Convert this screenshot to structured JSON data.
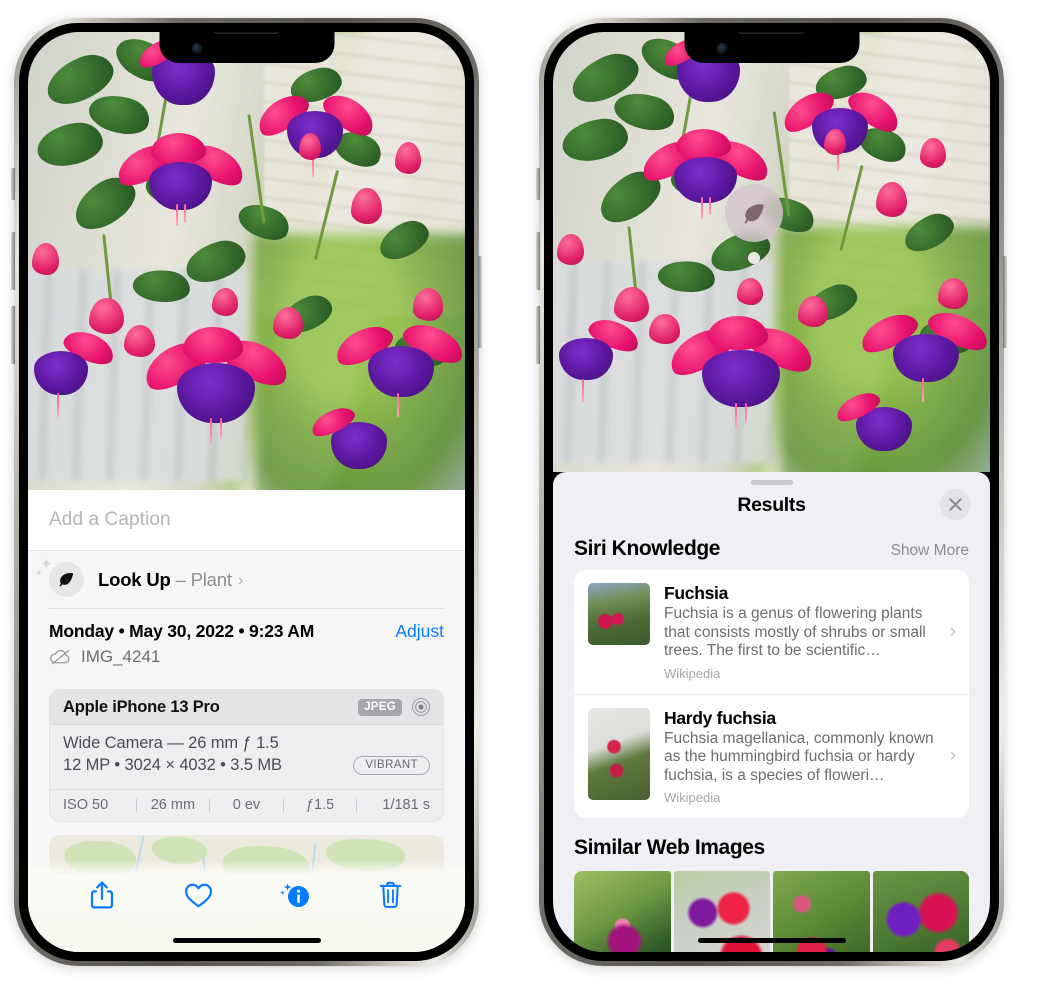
{
  "left_phone": {
    "photo_alt": "Fuchsia flowers hanging basket photo",
    "caption_placeholder": "Add a Caption",
    "lookup": {
      "label": "Look Up",
      "dash": "–",
      "subject": "Plant",
      "chevron": "›",
      "icon": "leaf-icon"
    },
    "metadata": {
      "date": "Monday • May 30, 2022 • 9:23 AM",
      "adjust_label": "Adjust",
      "filename": "IMG_4241",
      "cloud_icon": "icloud-slash-icon"
    },
    "camera_card": {
      "model": "Apple iPhone 13 Pro",
      "format_badge": "JPEG",
      "hdr_icon": "hdr-circle-icon",
      "lens": "Wide Camera — 26 mm ƒ 1.5",
      "resolution": "12 MP • 3024 × 4032 • 3.5 MB",
      "vibrant_badge": "VIBRANT",
      "exif": [
        "ISO 50",
        "26 mm",
        "0 ev",
        "ƒ1.5",
        "1/181 s"
      ]
    },
    "toolbar": [
      {
        "name": "share-button",
        "icon": "share-icon"
      },
      {
        "name": "favorite-button",
        "icon": "heart-icon"
      },
      {
        "name": "info-button",
        "icon": "info-sparkle-icon"
      },
      {
        "name": "delete-button",
        "icon": "trash-icon"
      }
    ]
  },
  "right_phone": {
    "visual_lookup_badge": {
      "icon": "leaf-icon"
    },
    "results_sheet": {
      "title": "Results",
      "close_icon": "close-icon",
      "sections": [
        {
          "title": "Siri Knowledge",
          "action_label": "Show More",
          "items": [
            {
              "title": "Fuchsia",
              "description": "Fuchsia is a genus of flowering plants that consists mostly of shrubs or small trees. The first to be scientific…",
              "source": "Wikipedia",
              "chevron": "›"
            },
            {
              "title": "Hardy fuchsia",
              "description": "Fuchsia magellanica, commonly known as the hummingbird fuchsia or hardy fuchsia, is a species of floweri…",
              "source": "Wikipedia",
              "chevron": "›"
            }
          ]
        },
        {
          "title": "Similar Web Images",
          "action_label": "",
          "images": [
            {
              "alt": "pink and magenta fuchsia with green leaves"
            },
            {
              "alt": "red fuchsia close-up on grey background"
            },
            {
              "alt": "fuchsia bush with red and purple blooms"
            },
            {
              "alt": "purple and red fuchsia flowers"
            }
          ]
        }
      ]
    }
  },
  "colors": {
    "accent_blue": "#067bff",
    "sheet_bg": "#f0eff3",
    "card_bg": "#ffffff",
    "secondary_text": "#8e8e93",
    "badge_grey": "#a5a5ac"
  }
}
